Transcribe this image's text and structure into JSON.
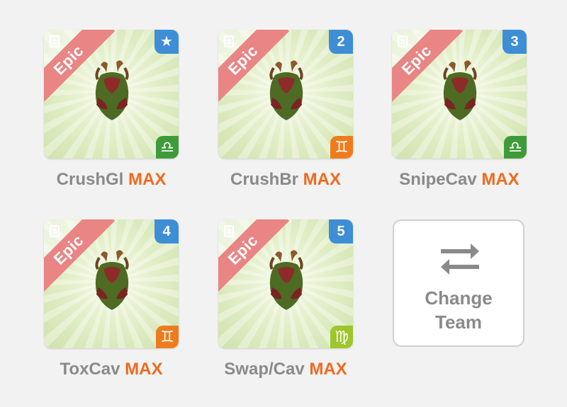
{
  "team": [
    {
      "name": "CrushGl",
      "level": "MAX",
      "rarity": "Epic",
      "slot_badge": "★",
      "badge_icon": "star-icon",
      "zodiac": "♎",
      "zodiac_icon": "libra-icon",
      "zodiac_color": "#3f9b3a"
    },
    {
      "name": "CrushBr",
      "level": "MAX",
      "rarity": "Epic",
      "slot_badge": "2",
      "badge_icon": "number-badge",
      "zodiac": "♊",
      "zodiac_icon": "gemini-icon",
      "zodiac_color": "#ef7c1c"
    },
    {
      "name": "SnipeCav",
      "level": "MAX",
      "rarity": "Epic",
      "slot_badge": "3",
      "badge_icon": "number-badge",
      "zodiac": "♎",
      "zodiac_icon": "libra-icon",
      "zodiac_color": "#3f9b3a"
    },
    {
      "name": "ToxCav",
      "level": "MAX",
      "rarity": "Epic",
      "slot_badge": "4",
      "badge_icon": "number-badge",
      "zodiac": "♊",
      "zodiac_icon": "gemini-icon",
      "zodiac_color": "#ef7c1c"
    },
    {
      "name": "Swap/Cav",
      "level": "MAX",
      "rarity": "Epic",
      "slot_badge": "5",
      "badge_icon": "number-badge",
      "zodiac": "♍",
      "zodiac_icon": "virgo-icon",
      "zodiac_color": "#9cc62a"
    }
  ],
  "change_team": {
    "line1": "Change",
    "line2": "Team",
    "icon": "swap-arrows-icon"
  },
  "colors": {
    "rarity_ribbon": "#e98585",
    "slot_badge": "#3e8ed6",
    "max_text": "#ef6a1e",
    "name_text": "#8a8a8a",
    "card_bg": "#dcebbf"
  }
}
